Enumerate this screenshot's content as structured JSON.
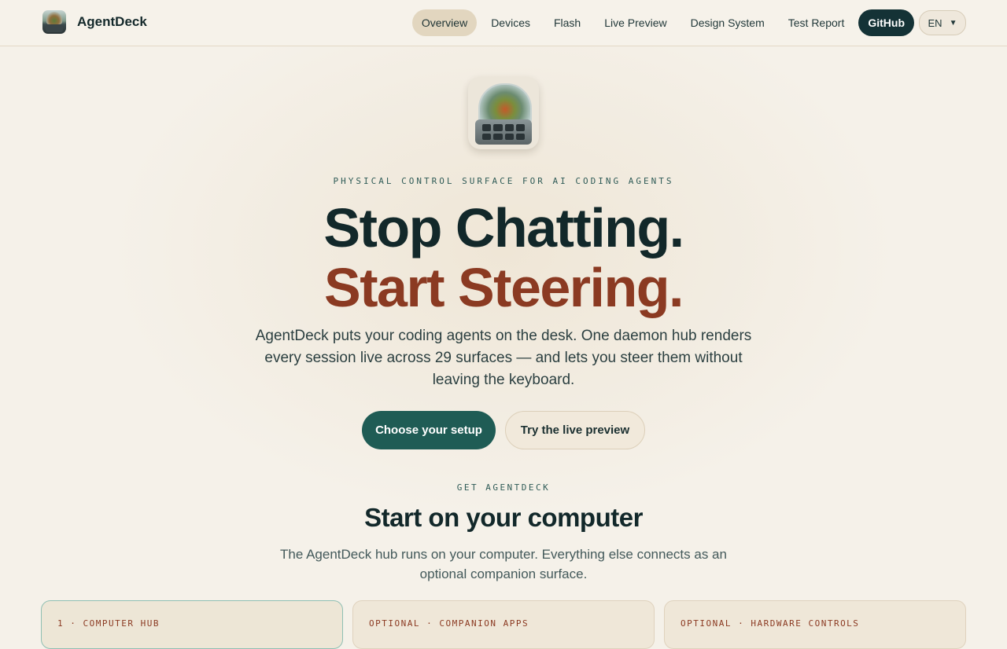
{
  "nav": {
    "brand": "AgentDeck",
    "links": [
      "Overview",
      "Devices",
      "Flash",
      "Live Preview",
      "Design System",
      "Test Report"
    ],
    "github": "GitHub",
    "language": "EN"
  },
  "hero": {
    "eyebrow": "PHYSICAL CONTROL SURFACE FOR AI CODING AGENTS",
    "headline_line1": "Stop Chatting.",
    "headline_line2": "Start Steering.",
    "lead": "AgentDeck puts your coding agents on the desk. One daemon hub renders every session live across 29 surfaces — and lets you steer them without leaving the keyboard.",
    "primary_cta": "Choose your setup",
    "secondary_cta": "Try the live preview"
  },
  "get": {
    "eyebrow": "GET AGENTDECK",
    "title": "Start on your computer",
    "lead": "The AgentDeck hub runs on your computer. Everything else connects as an optional companion surface.",
    "cards": [
      {
        "tag": "1 · COMPUTER HUB"
      },
      {
        "tag": "OPTIONAL · COMPANION APPS"
      },
      {
        "tag": "OPTIONAL · HARDWARE CONTROLS"
      }
    ]
  },
  "colors": {
    "background": "#f5f1e9",
    "primary": "#1f5c55",
    "headline_dark": "#12282a",
    "headline_accent": "#8b3a22",
    "nav_active": "#e2d6bf",
    "github_button": "#143236"
  }
}
